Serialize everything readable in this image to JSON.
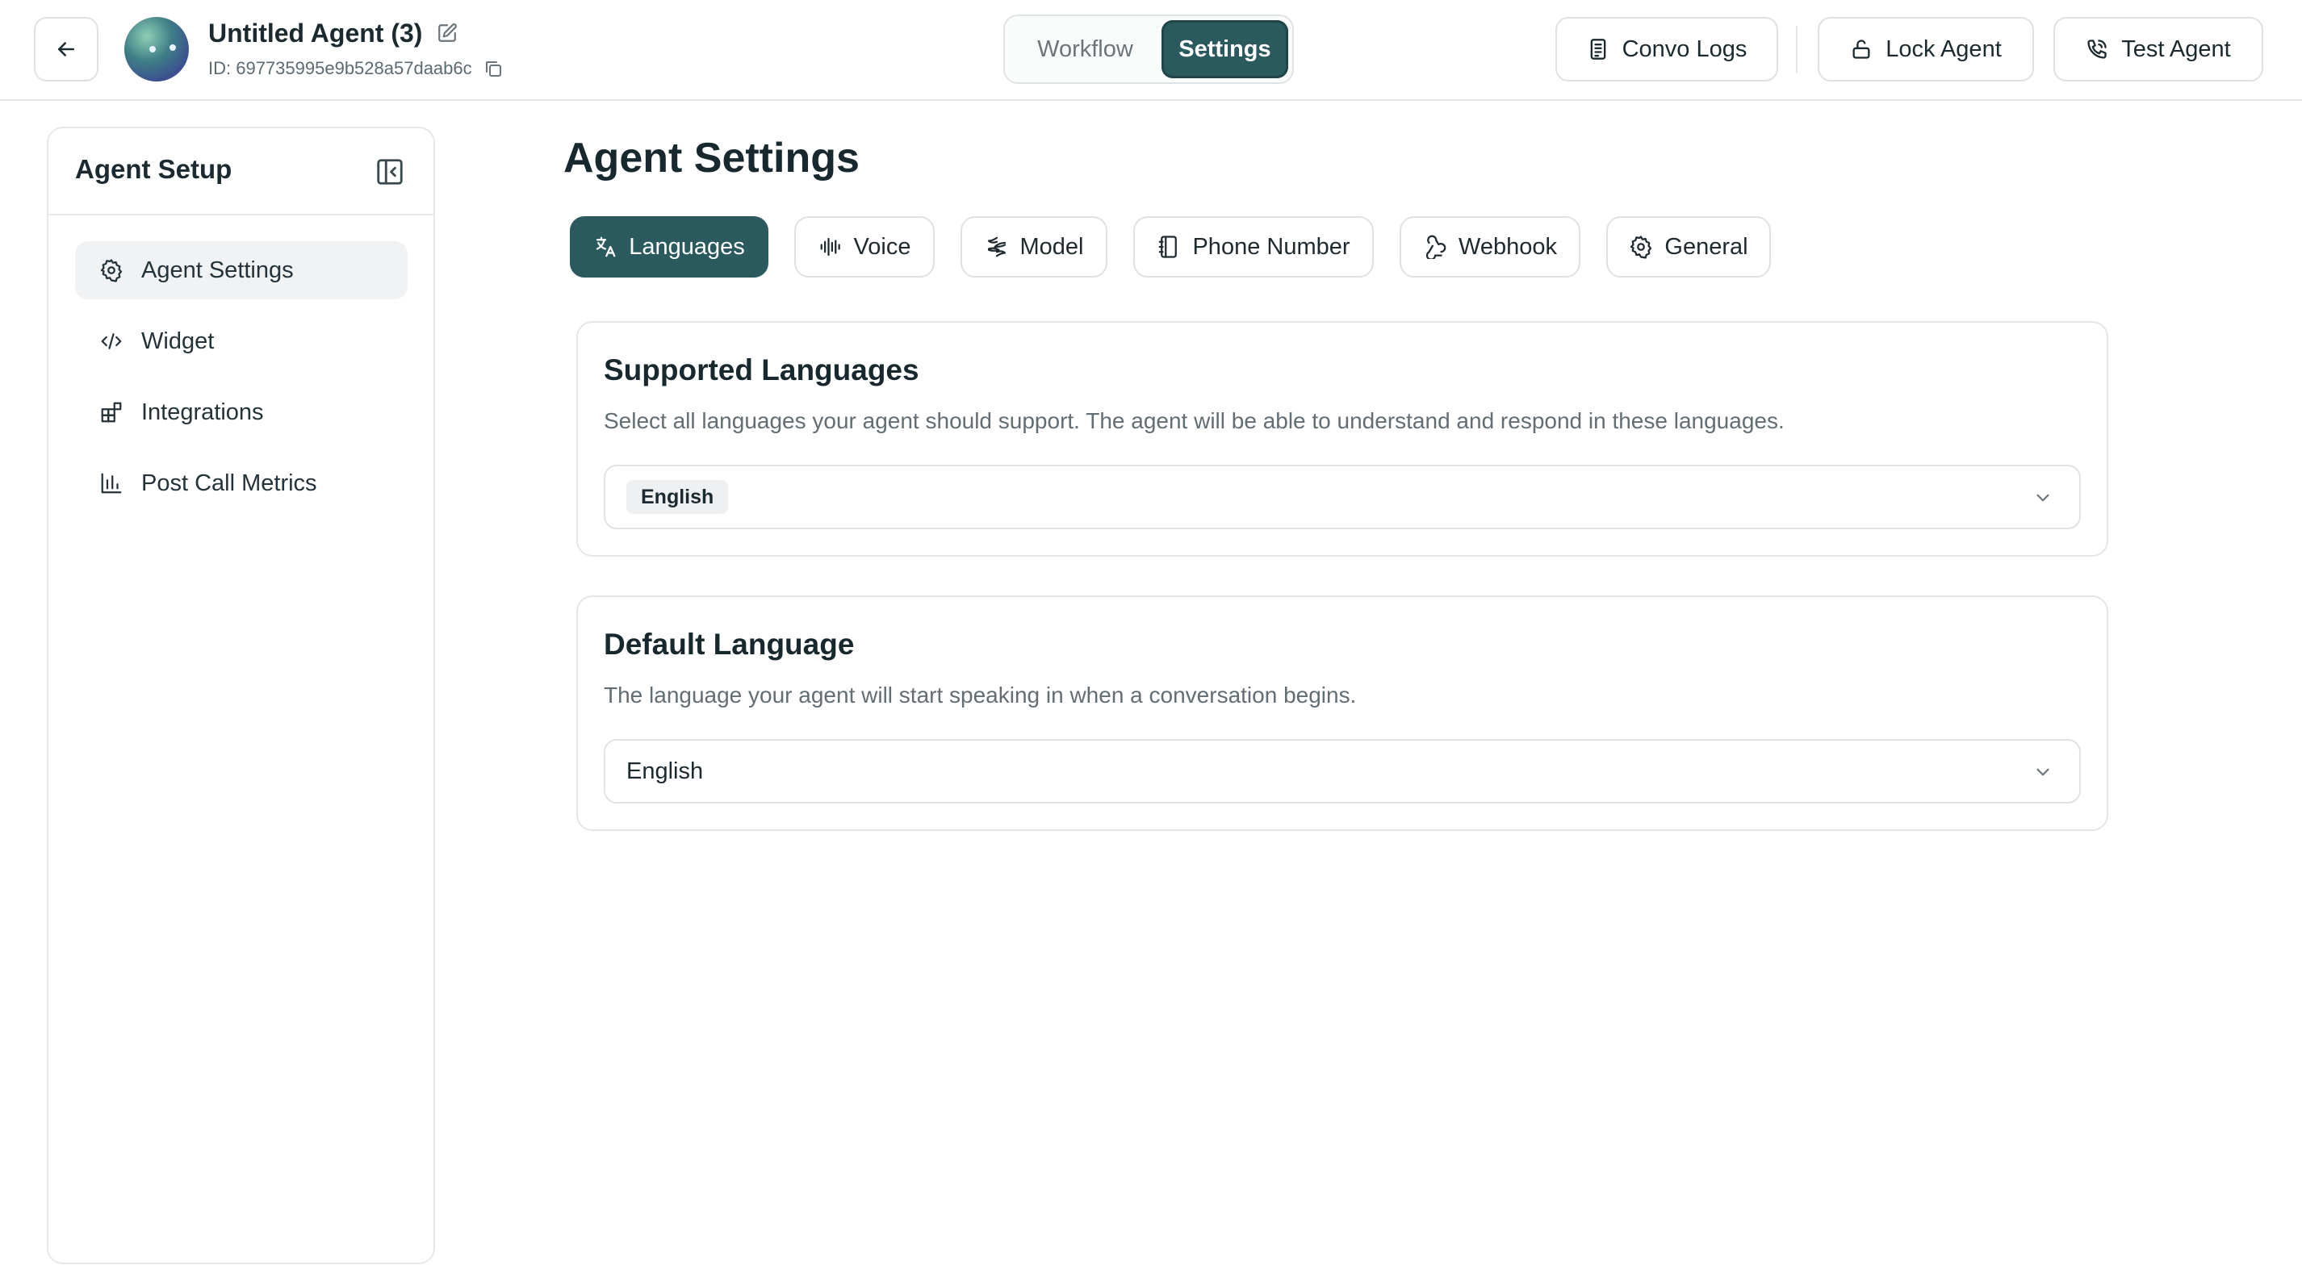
{
  "header": {
    "agent_name": "Untitled Agent (3)",
    "agent_id": "ID: 697735995e9b528a57daab6c",
    "view_tabs": [
      {
        "label": "Workflow",
        "active": false
      },
      {
        "label": "Settings",
        "active": true
      }
    ],
    "actions": {
      "convo_logs": "Convo Logs",
      "lock_agent": "Lock Agent",
      "test_agent": "Test Agent"
    },
    "icons": [
      "arrow-left-icon",
      "edit-icon",
      "copy-icon",
      "document-icon",
      "lock-icon",
      "phone-call-icon"
    ]
  },
  "sidebar": {
    "title": "Agent Setup",
    "items": [
      {
        "label": "Agent Settings",
        "icon": "gear-icon",
        "active": true
      },
      {
        "label": "Widget",
        "icon": "code-icon",
        "active": false
      },
      {
        "label": "Integrations",
        "icon": "blocks-icon",
        "active": false
      },
      {
        "label": "Post Call Metrics",
        "icon": "bar-chart-icon",
        "active": false
      }
    ]
  },
  "main": {
    "title": "Agent Settings",
    "tabs": [
      {
        "label": "Languages",
        "icon": "translate-icon",
        "active": true
      },
      {
        "label": "Voice",
        "icon": "audio-wave-icon",
        "active": false
      },
      {
        "label": "Model",
        "icon": "model-icon",
        "active": false
      },
      {
        "label": "Phone Number",
        "icon": "phone-book-icon",
        "active": false
      },
      {
        "label": "Webhook",
        "icon": "webhook-icon",
        "active": false
      },
      {
        "label": "General",
        "icon": "gear-icon",
        "active": false
      }
    ],
    "supported_languages": {
      "title": "Supported Languages",
      "description": "Select all languages your agent should support. The agent will be able to understand and respond in these languages.",
      "selected": [
        "English"
      ]
    },
    "default_language": {
      "title": "Default Language",
      "description": "The language your agent will start speaking in when a conversation begins.",
      "value": "English"
    }
  },
  "colors": {
    "accent": "#2b5a5e",
    "border": "#e3e6e8",
    "text": "#1b2a30",
    "muted": "#626d74"
  }
}
